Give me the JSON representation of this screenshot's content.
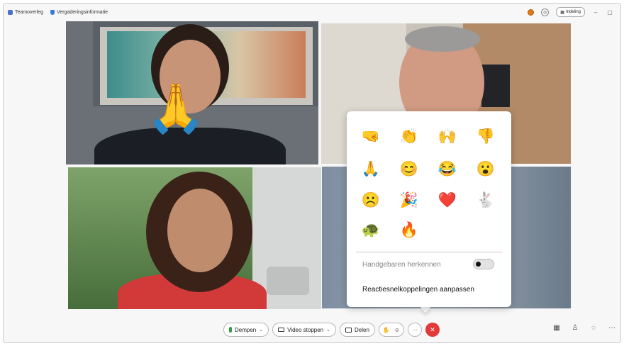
{
  "titlebar": {
    "app_name": "Teamoverleg",
    "meeting_info": "Vergaderingsinformatie",
    "layout_label": "Indeling",
    "minimize": "–",
    "restore": "▢"
  },
  "participants": [
    {
      "name": "",
      "reaction": "🙏"
    },
    {
      "name": ""
    },
    {
      "name": ""
    },
    {
      "name": ""
    }
  ],
  "reactions_popup": {
    "emojis": [
      {
        "name": "raised-fist",
        "glyph": "🤜"
      },
      {
        "name": "clapping-hands",
        "glyph": "👏"
      },
      {
        "name": "celebrating-hands",
        "glyph": "🙌"
      },
      {
        "name": "thumbs-down",
        "glyph": "👎"
      },
      {
        "name": "folded-hands",
        "glyph": "🙏"
      },
      {
        "name": "smiling-face",
        "glyph": "😊"
      },
      {
        "name": "laughing-face",
        "glyph": "😂"
      },
      {
        "name": "surprised-face",
        "glyph": "😮"
      },
      {
        "name": "sad-face",
        "glyph": "☹️"
      },
      {
        "name": "party-popper",
        "glyph": "🎉"
      },
      {
        "name": "heart",
        "glyph": "❤️"
      },
      {
        "name": "rabbit",
        "glyph": "🐇"
      },
      {
        "name": "turtle",
        "glyph": "🐢"
      },
      {
        "name": "fire",
        "glyph": "🔥"
      }
    ],
    "gesture_label": "Handgebaren herkennen",
    "gesture_toggle_on": false,
    "customize_label": "Reactiesnelkoppelingen aanpassen"
  },
  "controls": {
    "mute_label": "Dempen",
    "video_label": "Video stoppen",
    "share_label": "Delen",
    "more": "···",
    "end": "✕"
  },
  "colors": {
    "end_call": "#e23a3a",
    "mic_active": "#2e9d4a",
    "status": "#e07a1a"
  }
}
